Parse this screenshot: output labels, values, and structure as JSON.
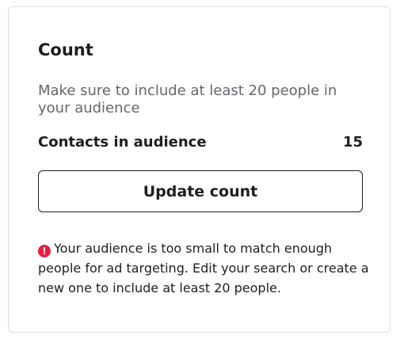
{
  "count_panel": {
    "title": "Count",
    "hint": "Make sure to include at least 20 people in your audience",
    "contacts_label": "Contacts in audience",
    "contacts_value": "15",
    "update_button_label": "Update count",
    "warning_text": "Your audience is too small to match enough people for ad targeting. Edit your search or create a new one to include at least 20 people.",
    "warning_icon": "alert-icon",
    "warning_icon_color": "#e41e3f"
  }
}
